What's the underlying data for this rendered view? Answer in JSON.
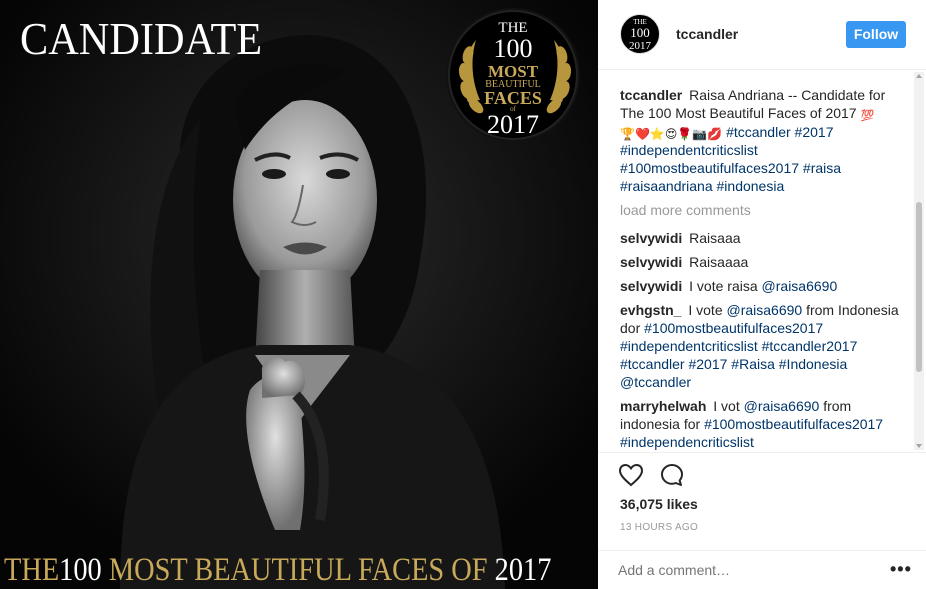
{
  "image": {
    "top_left_text": "CANDIDATE",
    "badge": {
      "the": "THE",
      "number": "100",
      "most": "MOST",
      "beautiful": "BEAUTIFUL",
      "faces": "FACES",
      "of": "of",
      "year": "2017"
    },
    "bottom_title": {
      "part1": "THE",
      "part2": "100",
      "part3": " MOST BEAUTIFUL FACES OF ",
      "part4": "2017"
    }
  },
  "header": {
    "avatar": {
      "the": "THE",
      "number": "100",
      "year": "2017"
    },
    "username": "tccandler",
    "follow_label": "Follow"
  },
  "caption": {
    "username": "tccandler",
    "text": "Raisa Andriana -- Candidate for The 100 Most Beautiful Faces of 2017",
    "emoji_line": "💯",
    "emojis": "🏆❤️⭐😍🌹📷💋",
    "tags_line1": "#tccandler #2017",
    "tags_line2": "#independentcriticslist",
    "tags_line3": "#100mostbeautifulfaces2017 #raisa",
    "tags_line4": "#raisaandriana #indonesia"
  },
  "load_more": "load more comments",
  "comments": [
    {
      "user": "selvywidi",
      "text": "Raisaaa"
    },
    {
      "user": "selvywidi",
      "text": "Raisaaaa"
    },
    {
      "user": "selvywidi",
      "text_prefix": "I vote raisa ",
      "mention": "@raisa6690"
    },
    {
      "user": "evhgstn_",
      "text_prefix": "I vote ",
      "mention": "@raisa6690",
      "text_suffix": " from Indonesia dor ",
      "tags": "#100mostbeautifulfaces2017 #independentcriticslist #tccandler2017 #tccandler #2017 #Raisa #Indonesia",
      "mention2": "@tccandler"
    },
    {
      "user": "marryhelwah",
      "text_prefix": "I vot ",
      "mention": "@raisa6690",
      "text_suffix": " from indonesia for ",
      "tags": "#100mostbeautifulfaces2017 #independencriticslist"
    }
  ],
  "likes": "36,075 likes",
  "time": "13 HOURS AGO",
  "add_comment_placeholder": "Add a comment…",
  "more_options": "•••",
  "colors": {
    "follow_blue": "#3897f0",
    "link_blue": "#003569",
    "gold": "#c9a95a"
  }
}
